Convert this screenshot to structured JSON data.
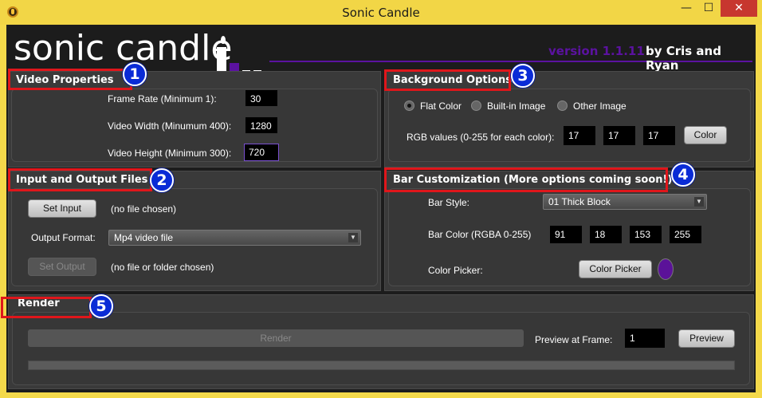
{
  "window": {
    "title": "Sonic Candle",
    "minimize": "—",
    "maximize": "☐",
    "close": "✕"
  },
  "header": {
    "logo_text": "sonic candle",
    "version": "version 1.1.11",
    "byline": "by Cris and Ryan"
  },
  "video_properties": {
    "title": "Video Properties",
    "badge": "1",
    "frame_rate_label": "Frame Rate (Minimum 1):",
    "frame_rate": "30",
    "width_label": "Video Width (Minumum 400):",
    "width": "1280",
    "height_label": "Video Height (Minimum 300):",
    "height": "720"
  },
  "io_files": {
    "title": "Input and Output Files",
    "badge": "2",
    "set_input_label": "Set Input",
    "input_status": "(no file chosen)",
    "output_format_label": "Output Format:",
    "output_format": "Mp4 video file",
    "set_output_label": "Set Output",
    "output_status": "(no file or folder chosen)"
  },
  "background": {
    "title": "Background Options",
    "badge": "3",
    "options": [
      "Flat Color",
      "Built-in Image",
      "Other Image"
    ],
    "selected": "Flat Color",
    "rgb_label": "RGB values (0-255 for each color):",
    "r": "17",
    "g": "17",
    "b": "17",
    "color_button": "Color"
  },
  "bar": {
    "title": "Bar Customization (More options coming soon!)",
    "badge": "4",
    "style_label": "Bar Style:",
    "style": "01 Thick Block",
    "color_label": "Bar Color (RGBA 0-255)",
    "r": "91",
    "g": "18",
    "b": "153",
    "a": "255",
    "picker_label": "Color Picker:",
    "picker_button": "Color Picker",
    "swatch_color": "#5b1299"
  },
  "render": {
    "title": "Render",
    "badge": "5",
    "render_button": "Render",
    "preview_label": "Preview at Frame:",
    "preview_frame": "1",
    "preview_button": "Preview",
    "progress": 0
  },
  "colors": {
    "accent": "#5b12a0",
    "highlight_box": "#e0161b",
    "badge": "#0a2bd6"
  }
}
